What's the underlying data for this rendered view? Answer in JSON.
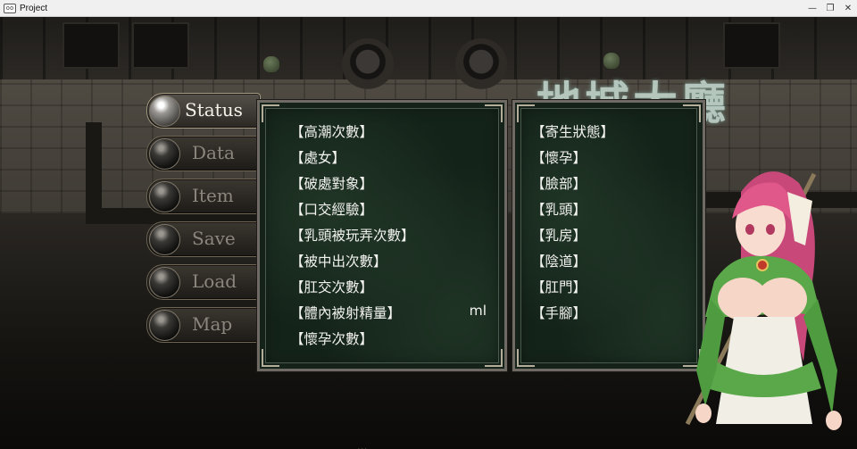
{
  "window": {
    "title": "Project",
    "icon_text": "oo",
    "controls": {
      "minimize": "—",
      "restore": "❐",
      "close": "✕"
    }
  },
  "map": {
    "sign_text": "地城大廳",
    "bottom_text": "..."
  },
  "menu": {
    "commands": [
      {
        "label": "Status",
        "active": true
      },
      {
        "label": "Data",
        "active": false
      },
      {
        "label": "Item",
        "active": false
      },
      {
        "label": "Save",
        "active": false
      },
      {
        "label": "Load",
        "active": false
      },
      {
        "label": "Map",
        "active": false
      }
    ]
  },
  "status_panel": {
    "rows": [
      {
        "label": "【高潮次數】",
        "unit": ""
      },
      {
        "label": "【處女】",
        "unit": ""
      },
      {
        "label": "【破處對象】",
        "unit": ""
      },
      {
        "label": "【口交經驗】",
        "unit": ""
      },
      {
        "label": "【乳頭被玩弄次數】",
        "unit": ""
      },
      {
        "label": "【被中出次數】",
        "unit": ""
      },
      {
        "label": "【肛交次數】",
        "unit": ""
      },
      {
        "label": "【體內被射精量】",
        "unit": "ml"
      },
      {
        "label": "【懷孕次數】",
        "unit": ""
      }
    ]
  },
  "body_panel": {
    "rows": [
      "【寄生狀態】",
      "【懷孕】",
      "【臉部】",
      "【乳頭】",
      "【乳房】",
      "【陰道】",
      "【肛門】",
      "【手腳】"
    ]
  },
  "colors": {
    "panel_bg": "#142319",
    "text": "#f2f2ee",
    "hair": "#e0578a",
    "outfit_green": "#5aa84a"
  }
}
